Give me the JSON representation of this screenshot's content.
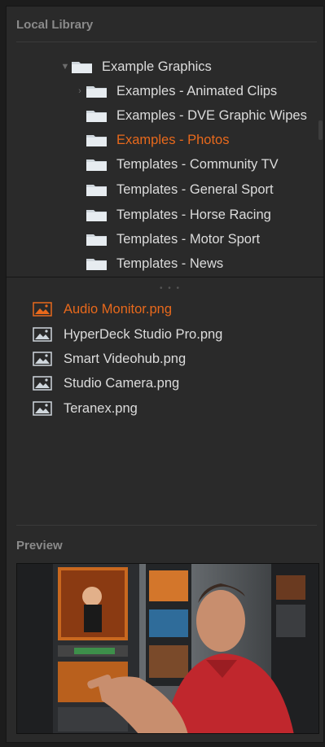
{
  "library": {
    "title": "Local Library",
    "tree": [
      {
        "label": "Example Graphics",
        "expanded": true,
        "selected": false
      },
      {
        "label": "Examples - Animated Clips",
        "collapsed_arrow": true,
        "selected": false
      },
      {
        "label": "Examples - DVE Graphic Wipes",
        "selected": false
      },
      {
        "label": "Examples - Photos",
        "selected": true
      },
      {
        "label": "Templates - Community TV",
        "selected": false
      },
      {
        "label": "Templates - General Sport",
        "selected": false
      },
      {
        "label": "Templates - Horse Racing",
        "selected": false
      },
      {
        "label": "Templates - Motor Sport",
        "selected": false
      },
      {
        "label": "Templates - News",
        "selected": false
      }
    ],
    "files": [
      {
        "label": "Audio Monitor.png",
        "selected": true
      },
      {
        "label": "HyperDeck Studio Pro.png",
        "selected": false
      },
      {
        "label": "Smart Videohub.png",
        "selected": false
      },
      {
        "label": "Studio Camera.png",
        "selected": false
      },
      {
        "label": "Teranex.png",
        "selected": false
      }
    ]
  },
  "preview": {
    "title": "Preview",
    "image_icon": "photo-man-pointing-at-monitors"
  },
  "colors": {
    "accent": "#e8691c",
    "text": "#dcdcdc",
    "panel": "#2a2a2a",
    "folder": "#cfd6dc"
  },
  "icons": {
    "expanded": "chevron-down-icon",
    "collapsed": "chevron-right-icon",
    "folder": "folder-icon",
    "image_file": "image-file-icon"
  }
}
